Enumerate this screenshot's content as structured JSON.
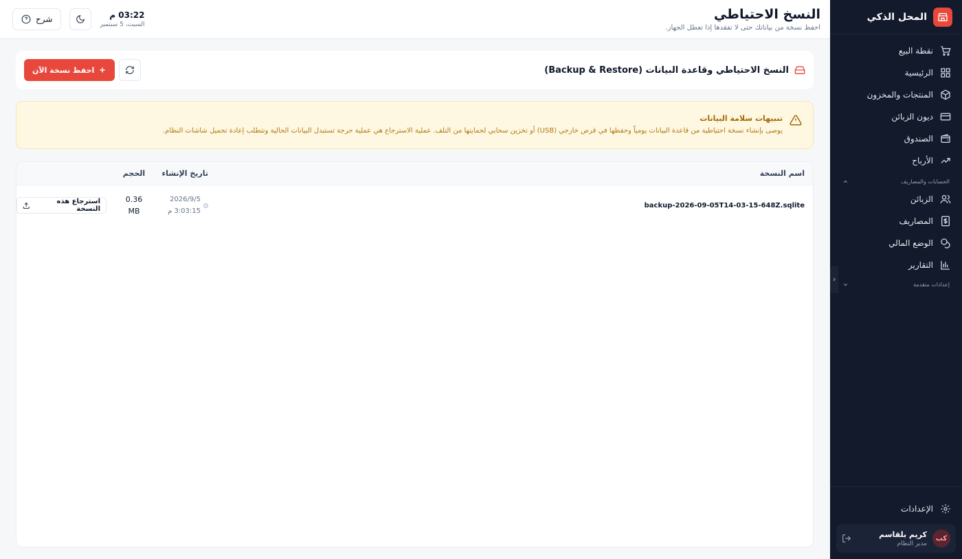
{
  "sidebar": {
    "brand": "المحل الذكي",
    "items": [
      {
        "label": "نقطة البيع",
        "icon": "cart-icon"
      },
      {
        "label": "الرئيسية",
        "icon": "grid-icon"
      },
      {
        "label": "المنتجات والمخزون",
        "icon": "box-icon"
      },
      {
        "label": "ديون الزبائن",
        "icon": "credit-card-icon"
      },
      {
        "label": "الصندوق",
        "icon": "wallet-icon"
      },
      {
        "label": "الأرباح",
        "icon": "trending-up-icon"
      }
    ],
    "section_accounts": "الحسابات والمصاريف",
    "accounts_items": [
      {
        "label": "الزبائن",
        "icon": "users-icon"
      },
      {
        "label": "المصاريف",
        "icon": "dollar-icon"
      },
      {
        "label": "الوضع المالي",
        "icon": "coins-icon"
      },
      {
        "label": "التقارير",
        "icon": "bar-chart-icon"
      }
    ],
    "section_advanced": "إعدادات متقدمة",
    "settings_label": "الإعدادات",
    "user": {
      "initials": "كب",
      "name": "كريم بلقاسم",
      "role": "مدير النظام"
    }
  },
  "header": {
    "title": "النسخ الاحتياطي",
    "subtitle": "احفظ نسخة من بياناتك حتى لا تفقدها إذا تعطل الجهاز.",
    "time": "03:22 م",
    "date": "السبت، 5 سبتمبر",
    "help_label": "شرح"
  },
  "backup": {
    "title": "النسخ الاحتياطي وقاعدة البيانات (Backup & Restore)",
    "save_now_label": "احفظ نسخة الآن",
    "alert_title": "تنبيهات سلامة البيانات",
    "alert_text": "يوصى بإنشاء نسخة احتياطية من قاعدة البيانات يومياً وحفظها في قرص خارجي (USB) أو تخزين سحابي لحمايتها من التلف. عملية الاسترجاع هي عملية حرجة تستبدل البيانات الحالية وتتطلب إعادة تحميل شاشات النظام.",
    "columns": {
      "name": "اسم النسخة",
      "date": "تاريخ الإنشاء",
      "size": "الحجم"
    },
    "rows": [
      {
        "name": "backup-2026-09-05T14-03-15-648Z.sqlite",
        "date": "2026/9/5",
        "time": "3:03:15 م",
        "size_value": "0.36",
        "size_unit": "MB",
        "restore_label": "استرجاع هذه النسخة"
      }
    ]
  },
  "colors": {
    "accent": "#e8473b",
    "sidebar_bg": "#121a2b",
    "warning_bg": "#fef7e1",
    "warning_text": "#a46a07"
  }
}
